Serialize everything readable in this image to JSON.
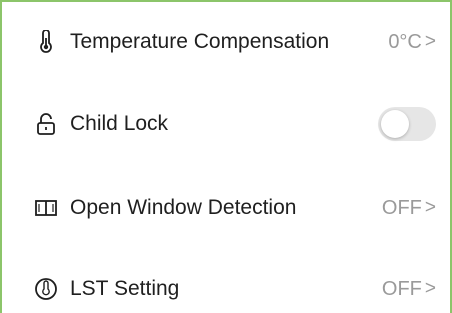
{
  "settings": {
    "items": [
      {
        "label": "Temperature Compensation",
        "value": "0°C",
        "icon": "thermometer-icon"
      },
      {
        "label": "Child Lock",
        "toggle_on": false,
        "icon": "lock-icon"
      },
      {
        "label": "Open Window Detection",
        "value": "OFF",
        "icon": "window-icon"
      },
      {
        "label": "LST Setting",
        "value": "OFF",
        "icon": "lst-icon"
      }
    ],
    "chevron": ">"
  },
  "colors": {
    "accent_border": "#8cc56a",
    "label": "#1f1f1f",
    "value": "#9a9a9a",
    "toggle_off": "#e6e6e6"
  }
}
